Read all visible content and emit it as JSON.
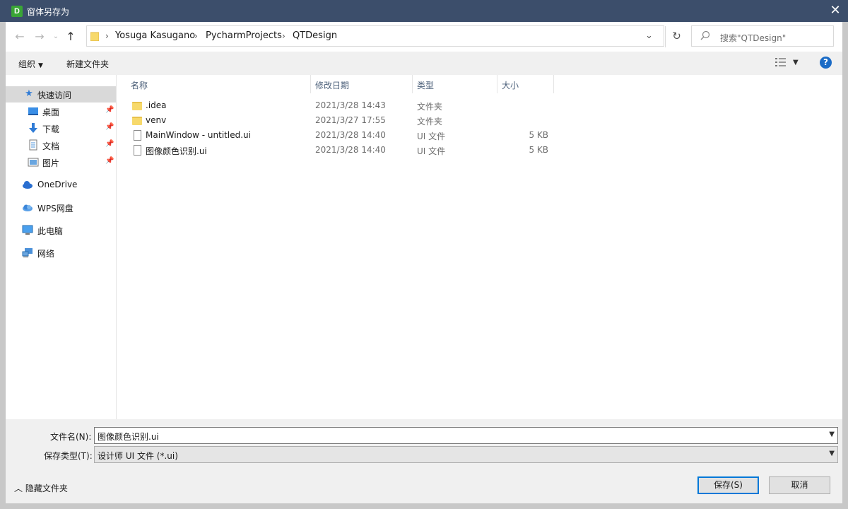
{
  "window": {
    "icon_letter": "D",
    "title": "窗体另存为",
    "close": "✕"
  },
  "nav": {
    "back": "←",
    "forward": "→",
    "recent": "⌄",
    "up": "↑",
    "breadcrumbs": [
      "Yosuga Kasugano",
      "PycharmProjects",
      "QTDesign"
    ],
    "separator": "›",
    "dropdown": "⌄",
    "refresh": "↻",
    "search_placeholder": "搜索\"QTDesign\""
  },
  "toolbar": {
    "organize": "组织",
    "new_folder": "新建文件夹",
    "help": "?"
  },
  "sidebar": {
    "items": [
      {
        "label": "快速访问",
        "icon": "star-icon"
      },
      {
        "label": "桌面",
        "icon": "desktop-icon",
        "pinned": true
      },
      {
        "label": "下载",
        "icon": "download-icon",
        "pinned": true
      },
      {
        "label": "文档",
        "icon": "document-icon",
        "pinned": true
      },
      {
        "label": "图片",
        "icon": "picture-icon",
        "pinned": true
      },
      {
        "label": "OneDrive",
        "icon": "cloud-icon"
      },
      {
        "label": "WPS网盘",
        "icon": "wps-cloud-icon"
      },
      {
        "label": "此电脑",
        "icon": "computer-icon"
      },
      {
        "label": "网络",
        "icon": "network-icon"
      }
    ]
  },
  "columns": {
    "name": "名称",
    "modified": "修改日期",
    "type": "类型",
    "size": "大小"
  },
  "files": [
    {
      "name": ".idea",
      "modified": "2021/3/28 14:43",
      "type": "文件夹",
      "size": "",
      "kind": "folder"
    },
    {
      "name": "venv",
      "modified": "2021/3/27 17:55",
      "type": "文件夹",
      "size": "",
      "kind": "folder"
    },
    {
      "name": "MainWindow - untitled.ui",
      "modified": "2021/3/28 14:40",
      "type": "UI 文件",
      "size": "5 KB",
      "kind": "file"
    },
    {
      "name": "图像颜色识别.ui",
      "modified": "2021/3/28 14:40",
      "type": "UI 文件",
      "size": "5 KB",
      "kind": "file"
    }
  ],
  "form": {
    "filename_label": "文件名(N):",
    "filename_value": "图像颜色识别.ui",
    "filetype_label": "保存类型(T):",
    "filetype_value": "设计师 UI 文件 (*.ui)"
  },
  "footer": {
    "hide_folders": "隐藏文件夹",
    "save": "保存(S)",
    "cancel": "取消"
  },
  "colors": {
    "titlebar": "#3c4e6b",
    "accent": "#0078d7",
    "folder": "#f7d96b"
  }
}
